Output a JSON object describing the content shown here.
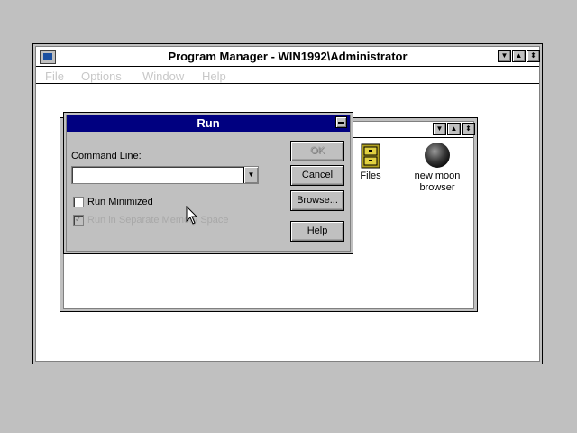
{
  "program_manager": {
    "title": "Program Manager - WIN1992\\Administrator",
    "menu": [
      "File",
      "Options",
      "Window",
      "Help"
    ],
    "controls": {
      "minimize": "▼",
      "maximize": "▲",
      "restore": "⬍"
    }
  },
  "group_window": {
    "controls": {
      "minimize": "▼",
      "maximize": "▲",
      "restore": "⬍"
    },
    "icons": [
      {
        "label": "Files",
        "icon": "file-cabinet-icon"
      },
      {
        "label": "new moon\nbrowser",
        "icon": "moon-globe-icon"
      }
    ]
  },
  "run_dialog": {
    "title": "Run",
    "command_line_label": "Command Line:",
    "command_line_value": "",
    "run_minimized_label": "Run Minimized",
    "run_minimized_checked": false,
    "separate_memory_label": "Run in Separate Memory Space",
    "separate_memory_checked": true,
    "buttons": {
      "ok": "OK",
      "cancel": "Cancel",
      "browse": "Browse...",
      "help": "Help"
    }
  }
}
